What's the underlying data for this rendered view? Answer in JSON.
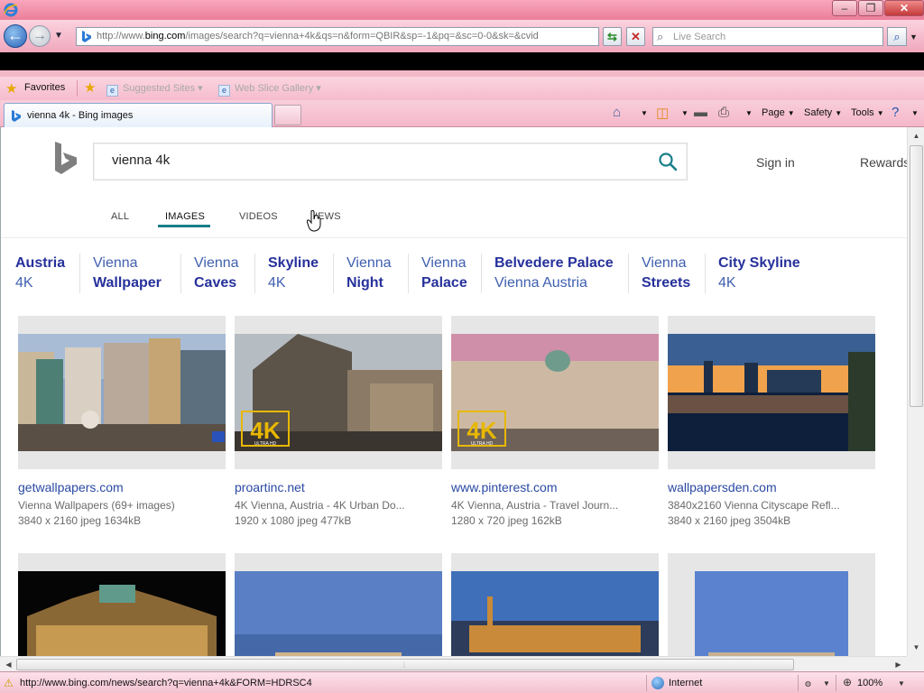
{
  "browser": {
    "address_url_prefix": "http://www.",
    "address_url_domain": "bing.com",
    "address_url_path": "/images/search?q=vienna+4k&qs=n&form=QBIR&sp=-1&pq=&sc=0-0&sk=&cvid",
    "search_placeholder": "Live Search",
    "favorites_label": "Favorites",
    "fav_items": [
      "Suggested Sites",
      "Web Slice Gallery"
    ],
    "tab_title": "vienna 4k - Bing images",
    "commands": [
      "Page",
      "Safety",
      "Tools"
    ],
    "status_url": "http://www.bing.com/news/search?q=vienna+4k&FORM=HDRSC4",
    "zone": "Internet",
    "zoom": "100%"
  },
  "bing": {
    "query": "vienna 4k",
    "sign_in": "Sign in",
    "rewards": "Rewards",
    "scopes": [
      "ALL",
      "IMAGES",
      "VIDEOS",
      "NEWS"
    ],
    "active_scope": "IMAGES",
    "brand_color": "#177e89",
    "related": [
      {
        "line1": "Austria",
        "line2": "4K"
      },
      {
        "line1": "Vienna",
        "line2": "Wallpaper"
      },
      {
        "line1": "Vienna",
        "line2": "Caves"
      },
      {
        "line1": "Skyline",
        "line2": "4K"
      },
      {
        "line1": "Vienna",
        "line2": "Night"
      },
      {
        "line1": "Vienna",
        "line2": "Palace"
      },
      {
        "line1": "Belvedere Palace",
        "line2": "Vienna Austria"
      },
      {
        "line1": "Vienna",
        "line2": "Streets"
      },
      {
        "line1": "City Skyline",
        "line2": "4K"
      }
    ],
    "results": [
      {
        "site": "getwallpapers.com",
        "title": "Vienna Wallpapers (69+ images)",
        "meta": "3840 x 2160 jpeg 1634kB",
        "badge": ""
      },
      {
        "site": "proartinc.net",
        "title": "4K Vienna, Austria - 4K Urban Do...",
        "meta": "1920 x 1080 jpeg 477kB",
        "badge": "4K"
      },
      {
        "site": "www.pinterest.com",
        "title": "4K Vienna, Austria - Travel Journ...",
        "meta": "1280 x 720 jpeg 162kB",
        "badge": "4K"
      },
      {
        "site": "wallpapersden.com",
        "title": "3840x2160 Vienna Cityscape Refl...",
        "meta": "3840 x 2160 jpeg 3504kB",
        "badge": ""
      }
    ],
    "badge_sub": "ULTRA HD"
  }
}
